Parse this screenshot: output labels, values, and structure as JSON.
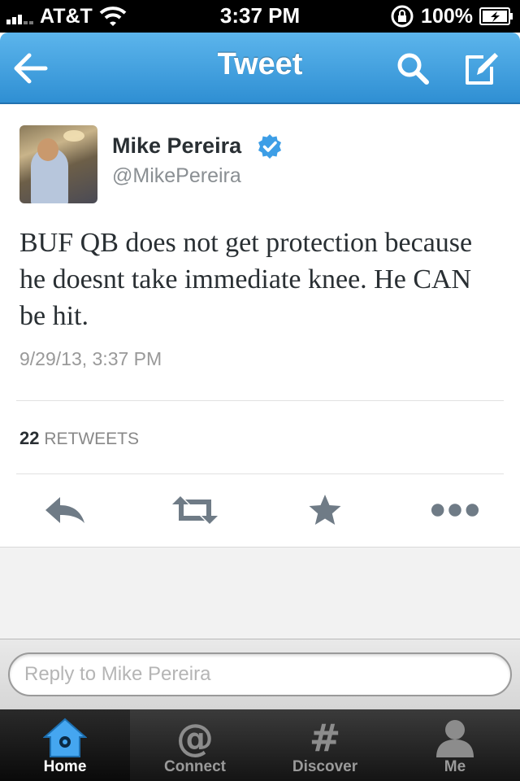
{
  "status_bar": {
    "carrier": "AT&T",
    "time": "3:37 PM",
    "battery": "100%",
    "signal_bars": 5
  },
  "nav": {
    "title": "Tweet",
    "back_icon": "back-arrow-icon",
    "search_icon": "search-icon",
    "compose_icon": "compose-icon"
  },
  "tweet": {
    "author_name": "Mike Pereira",
    "author_handle": "@MikePereira",
    "verified": true,
    "text": "BUF QB does not get protection because he doesnt take immediate knee. He CAN be hit.",
    "timestamp": "9/29/13, 3:37 PM",
    "retweet_count": "22",
    "retweet_label": "RETWEETS",
    "actions": [
      "reply-icon",
      "retweet-icon",
      "favorite-icon",
      "more-icon"
    ]
  },
  "reply": {
    "placeholder": "Reply to Mike Pereira",
    "value": ""
  },
  "tabs": [
    {
      "label": "Home",
      "icon": "home-icon",
      "active": true
    },
    {
      "label": "Connect",
      "icon": "at-icon",
      "active": false
    },
    {
      "label": "Discover",
      "icon": "hash-icon",
      "active": false
    },
    {
      "label": "Me",
      "icon": "person-icon",
      "active": false
    }
  ],
  "colors": {
    "nav_blue": "#3f9fe0",
    "verified_blue": "#3d9ee6",
    "home_icon_blue": "#45a6f0"
  }
}
